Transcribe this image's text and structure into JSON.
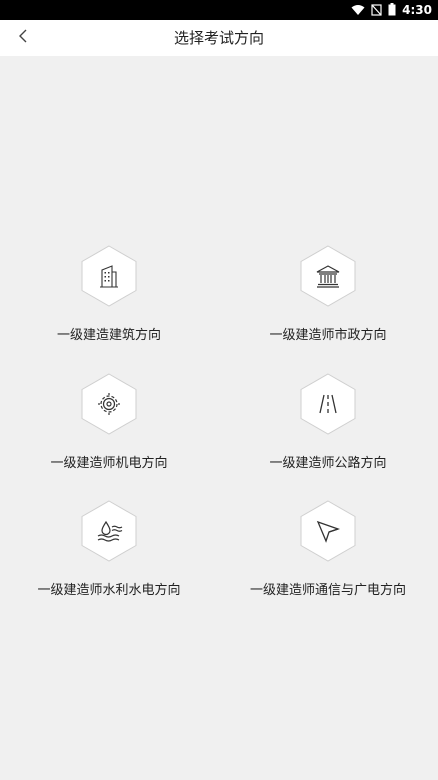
{
  "status_bar": {
    "time": "4:30",
    "icons": [
      "wifi-icon",
      "no-sim-icon",
      "battery-icon"
    ]
  },
  "navbar": {
    "back_icon": "chevron-left-icon",
    "title": "选择考试方向"
  },
  "options": [
    {
      "label": "一级建造建筑方向",
      "icon": "building-icon"
    },
    {
      "label": "一级建造师市政方向",
      "icon": "government-building-icon"
    },
    {
      "label": "一级建造师机电方向",
      "icon": "gear-icon"
    },
    {
      "label": "一级建造师公路方向",
      "icon": "road-icon"
    },
    {
      "label": "一级建造师水利水电方向",
      "icon": "water-drop-icon"
    },
    {
      "label": "一级建造师通信与广电方向",
      "icon": "send-arrow-icon"
    }
  ],
  "colors": {
    "background": "#f0f0f0",
    "navbar": "#ffffff",
    "status_bar": "#000000",
    "hex_fill": "#ffffff",
    "hex_stroke": "#cfcfcf",
    "text": "#222222"
  }
}
